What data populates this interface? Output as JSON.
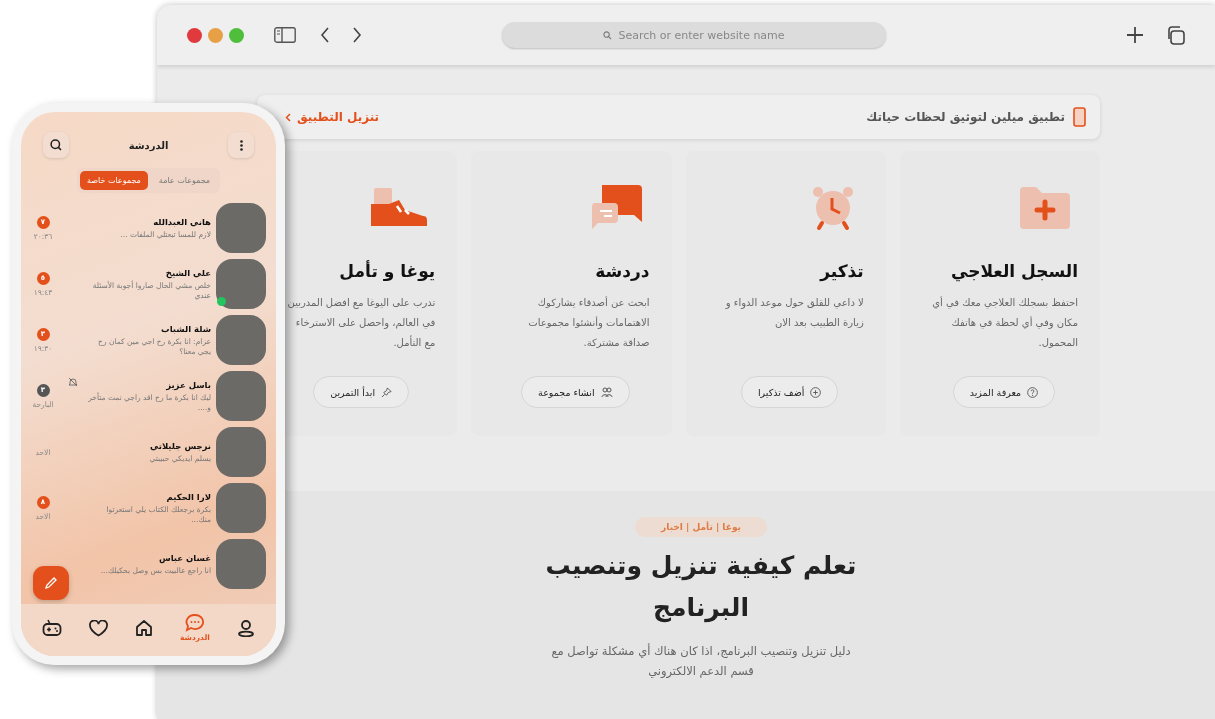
{
  "browser": {
    "address_placeholder": "Search or enter website name"
  },
  "banner": {
    "text": "تطبيق ميلين لتوثيق لحظات حياتك",
    "link": "تنزيل التطبيق"
  },
  "cards": [
    {
      "title": "السجل العلاجي",
      "text": "احتفظ بسجلك العلاجي معك في أي مكان وفي أي لحظة في هاتفك المحمول.",
      "button": "معرفة المزيد"
    },
    {
      "title": "تذكير",
      "text": "لا داعي للقلق حول موعد الدواء و زيارة الطبيب بعد الان",
      "button": "أضف تذكيرا"
    },
    {
      "title": "دردشة",
      "text": "ابحث عن أصدقاء يشاركوك الاهتمامات وأنشئوا مجموعات صداقة مشتركة.",
      "button": "انشاء مجموعة"
    },
    {
      "title": "يوغا و تأمل",
      "text": "تدرب على اليوغا مع افضل المدربين في العالم، واحصل على الاسترخاء مع التأمل.",
      "button": "ابدأ التمرين"
    }
  ],
  "section": {
    "tag": "يوغا | تأمل | اخبار",
    "heading": "تعلم كيفية تنزيل وتنصيب البرنامج",
    "text": "دليل تنزيل وتنصيب البرنامج، اذا كان هناك أي مشكلة تواصل مع قسم الدعم الالكتروني"
  },
  "phone": {
    "title": "الدردشة",
    "tabs": [
      {
        "label": "مجموعات عامة",
        "selected": false
      },
      {
        "label": "مجموعات خاصة",
        "selected": true
      }
    ],
    "chats": [
      {
        "name": "هاني العبدالله",
        "preview": "لازم للمسا تبعتلي الملفات ...",
        "time": "٢٠:٣٦",
        "badge": "٧",
        "online": false,
        "muted": false
      },
      {
        "name": "علي الشيخ",
        "preview": "خلص مشي الحال صاروا أجوبة الأسئلة عندي",
        "time": "١٩:٤٣",
        "badge": "٥",
        "online": true,
        "muted": false
      },
      {
        "name": "شلة الشباب",
        "preview": "عزام: انا بكرة رح اجي مين كمان رح يجي معنا؟",
        "time": "١٩:٣٠",
        "badge": "٣",
        "online": false,
        "muted": false
      },
      {
        "name": "باسل عزيز",
        "preview": "ليك انا بكرة ما رح اقد راجي نمت متأخر و....",
        "time": "البارحة",
        "badge": "٣",
        "online": false,
        "muted": true
      },
      {
        "name": "نرجس جليلاتي",
        "preview": "يسلم ايديكي حبيبتي",
        "time": "الاحد",
        "online": false,
        "muted": false
      },
      {
        "name": "لارا الحكيم",
        "preview": "بكرة برجعلك الكتاب يلي استعرتوا منك...",
        "time": "الاحد",
        "badge": "٨",
        "online": false,
        "muted": false
      },
      {
        "name": "غسان عباس",
        "preview": "انا راجع عالبيت بس وصل بحكيلك...",
        "online": false,
        "muted": false
      }
    ],
    "nav": [
      {
        "selected": false
      },
      {
        "selected": true,
        "label": "الدردشة"
      },
      {
        "selected": false
      },
      {
        "selected": false
      },
      {
        "selected": false
      }
    ]
  }
}
